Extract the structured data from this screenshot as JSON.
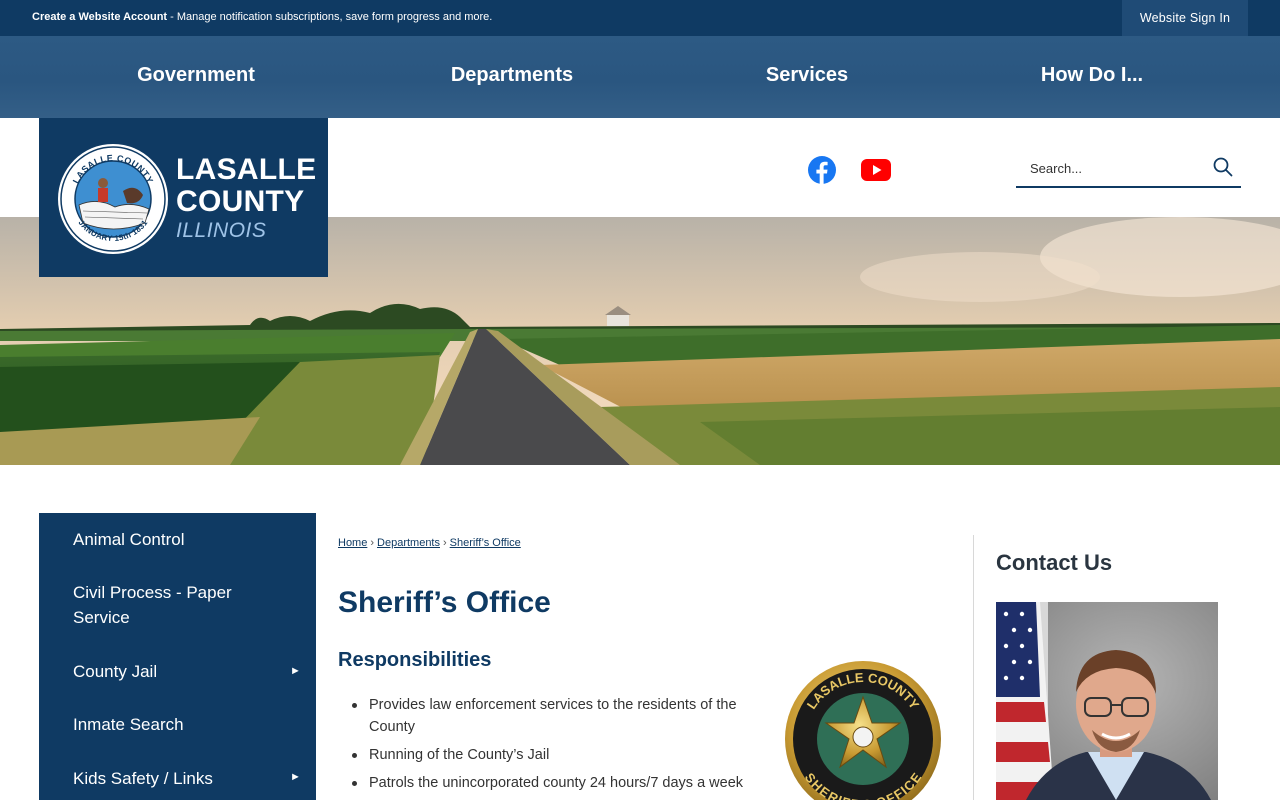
{
  "topbar": {
    "account_link": "Create a Website Account",
    "account_text": " - Manage notification subscriptions, save form progress and more.",
    "signin_label": "Website Sign In"
  },
  "nav": {
    "items": [
      "Government",
      "Departments",
      "Services",
      "How Do I..."
    ]
  },
  "logo": {
    "line1": "LASALLE",
    "line2": "COUNTY",
    "line3": "ILLINOIS",
    "seal_top": "LASALLE COUNTY",
    "seal_bottom": "JANUARY 15th 1831"
  },
  "social": {
    "facebook": "facebook-icon",
    "youtube": "youtube-icon"
  },
  "search": {
    "placeholder": "Search..."
  },
  "sidenav": {
    "items": [
      {
        "label": "Animal Control",
        "has_submenu": false
      },
      {
        "label": "Civil Process - Paper Service",
        "has_submenu": false
      },
      {
        "label": "County Jail",
        "has_submenu": true
      },
      {
        "label": "Inmate Search",
        "has_submenu": false
      },
      {
        "label": "Kids Safety / Links",
        "has_submenu": true
      }
    ],
    "arrow": "►"
  },
  "breadcrumb": {
    "items": [
      "Home",
      "Departments",
      "Sheriff’s Office"
    ],
    "separator": "›"
  },
  "page": {
    "title": "Sheriff’s Office",
    "subhead": "Responsibilities",
    "responsibilities": [
      "Provides law enforcement services to the residents of the County",
      "Running of the County’s Jail",
      "Patrols the unincorporated county 24 hours/7 days a week"
    ],
    "badge_top": "LASALLE COUNTY",
    "badge_bottom": "SHERIFF'S OFFICE"
  },
  "sidebar": {
    "contact_title": "Contact Us"
  },
  "colors": {
    "navy": "#0f3a63",
    "nav_blue": "#2d5a84",
    "signin_bg": "#1f4b76",
    "facebook": "#1877f2",
    "youtube": "#ff0000"
  }
}
